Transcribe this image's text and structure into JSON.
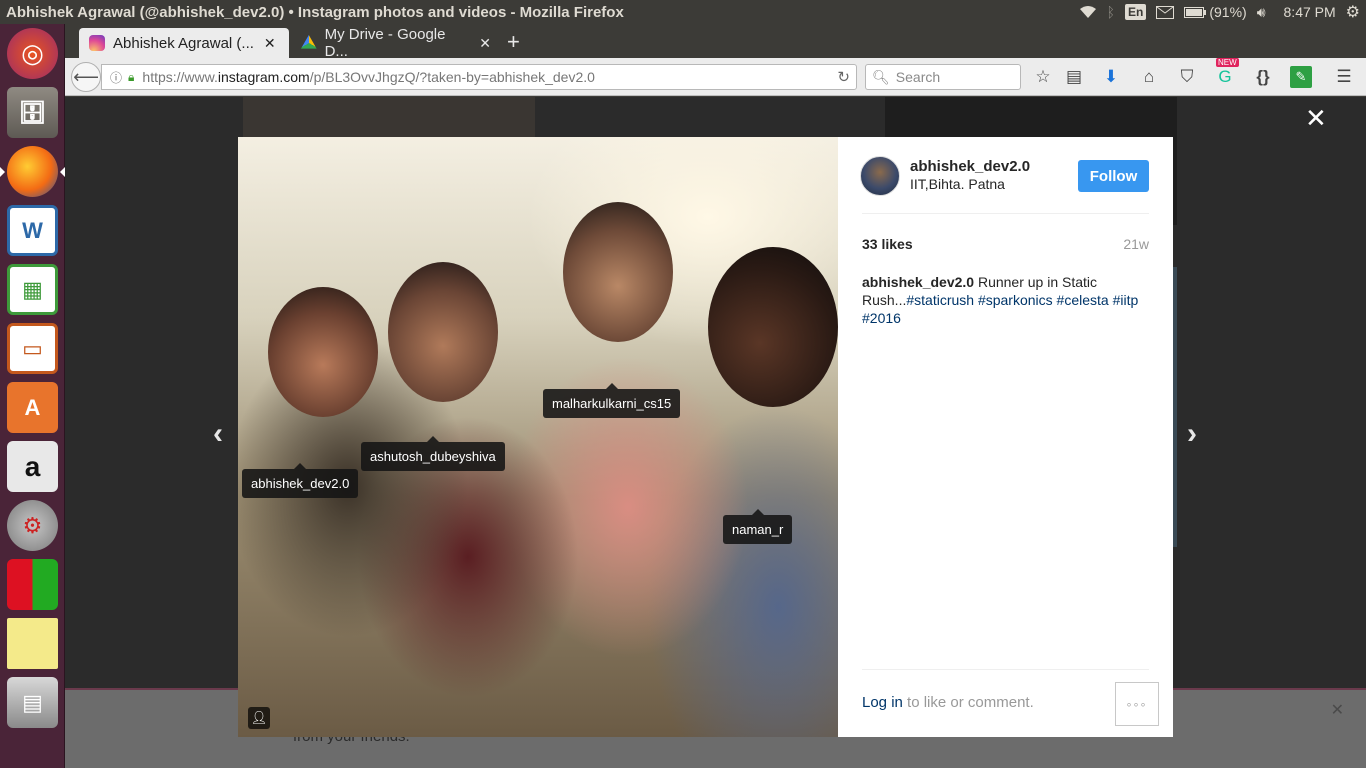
{
  "topbar": {
    "window_title": "Abhishek Agrawal (@abhishek_dev2.0) • Instagram photos and videos - Mozilla Firefox",
    "keyboard_layout": "En",
    "battery": "(91%)",
    "time": "8:47 PM"
  },
  "launcher": {
    "items": [
      "ubuntu-dash",
      "files",
      "firefox",
      "libreoffice-writer",
      "libreoffice-calc",
      "libreoffice-impress",
      "ubuntu-software",
      "amazon",
      "system-settings",
      "workspaces",
      "sticky-notes",
      "scanner"
    ]
  },
  "tabs": [
    {
      "label": "Abhishek Agrawal (...",
      "active": true
    },
    {
      "label": "My Drive - Google D...",
      "active": false
    }
  ],
  "navbar": {
    "url_prefix": "https://www.",
    "url_host": "instagram.com",
    "url_path": "/p/BL3OvvJhgzQ/?taken-by=abhishek_dev2.0",
    "search_placeholder": "Search",
    "new_badge": "NEW"
  },
  "page": {
    "bottom_text": "from your friends."
  },
  "post": {
    "username": "abhishek_dev2.0",
    "location": "IIT,Bihta. Patna",
    "follow_label": "Follow",
    "likes": "33 likes",
    "age": "21w",
    "caption_user": "abhishek_dev2.0",
    "caption_text_1": " Runner up in Static Rush...",
    "hashtags": [
      "#staticrush",
      "#sparkonics",
      "#celesta",
      "#iitp",
      "#2016"
    ],
    "login_link": "Log in",
    "login_text": " to like or comment.",
    "more_label": "◦◦◦"
  },
  "photo_tags": [
    {
      "label": "malharkulkarni_cs15"
    },
    {
      "label": "ashutosh_dubeyshiva"
    },
    {
      "label": "abhishek_dev2.0"
    },
    {
      "label": "naman_r"
    }
  ],
  "colors": {
    "follow_button": "#3897f0",
    "hashtag": "#003569",
    "launcher_bg": "#4a2438",
    "panel_bg": "#3c3b37"
  }
}
